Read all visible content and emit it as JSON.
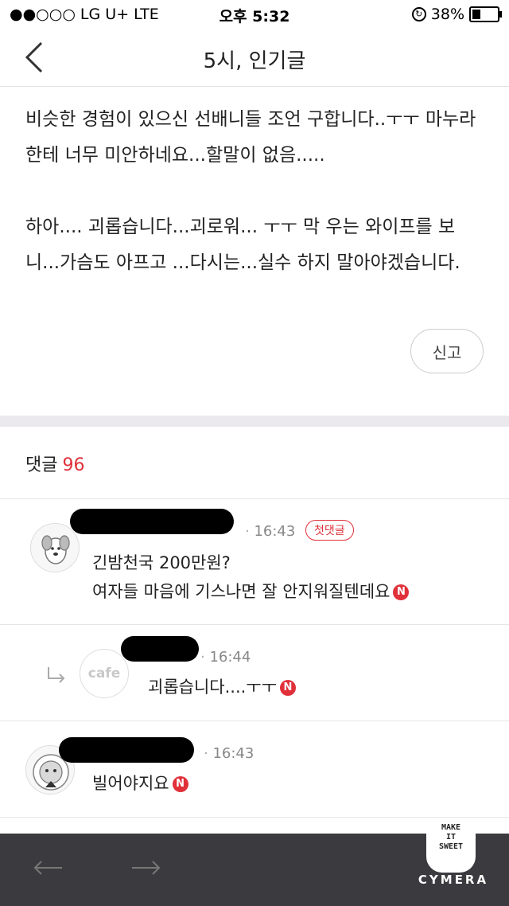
{
  "status_bar": {
    "carrier": "●●○○○ LG U+   LTE",
    "time": "오후 5:32",
    "battery_text": "38%",
    "battery_level": 0.38
  },
  "nav": {
    "title": "5시, 인기글",
    "back_icon": "chevron-left-icon"
  },
  "post": {
    "paragraph1": "비슷한 경험이 있으신 선배니들 조언 구합니다..ㅜㅜ 마누라 한테 너무 미안하네요...할말이 없음.....",
    "paragraph2": "하아.... 괴롭습니다...괴로워... ㅜㅜ 막 우는 와이프를 보니...가슴도 아프고 ...다시는...실수 하지 말아야겠습니다.",
    "report_label": "신고"
  },
  "comments_header": {
    "label": "댓글",
    "count": "96"
  },
  "comments": [
    {
      "time": "16:43",
      "badge": "첫댓글",
      "line1": "긴밤천국 200만원?",
      "line2": "여자들 마음에 기스나면 잘 안지워질텐데요",
      "new_badge": "N"
    },
    {
      "avatar_label": "cafe",
      "time": "16:44",
      "line1": "괴롭습니다....ㅜㅜ",
      "new_badge": "N"
    },
    {
      "time": "16:43",
      "line1": "빌어야지요",
      "new_badge": "N"
    }
  ],
  "bottom_bar": {
    "back_icon": "arrow-left-icon",
    "forward_icon": "arrow-right-icon"
  },
  "watermark": {
    "cup_text": "MAKE\nIT\nSWEET",
    "brand": "CYMERA"
  },
  "colors": {
    "accent": "#e0303a",
    "bottom_bar": "#3b3b3f",
    "divider": "#ebe8ee"
  }
}
